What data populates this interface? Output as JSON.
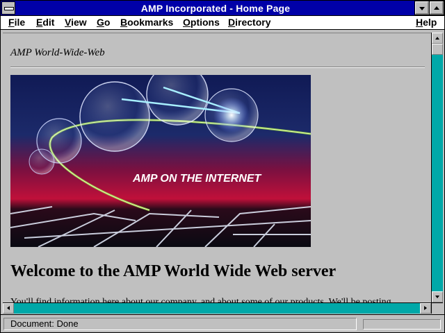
{
  "window": {
    "title": "AMP Incorporated - Home Page"
  },
  "menubar": {
    "items": [
      "File",
      "Edit",
      "View",
      "Go",
      "Bookmarks",
      "Options",
      "Directory"
    ],
    "help": "Help"
  },
  "page": {
    "site_title": "AMP World-Wide-Web",
    "banner_text": "AMP ON THE INTERNET",
    "heading": "Welcome to the AMP World Wide Web server",
    "intro": "You'll find information here about our company, and about some of our products. We'll be posting"
  },
  "statusbar": {
    "status": "Document: Done",
    "progress": 0
  },
  "colors": {
    "titlebar": "#0000a8",
    "scroll_track": "#00a8a8",
    "chrome": "#c0c0c0"
  }
}
